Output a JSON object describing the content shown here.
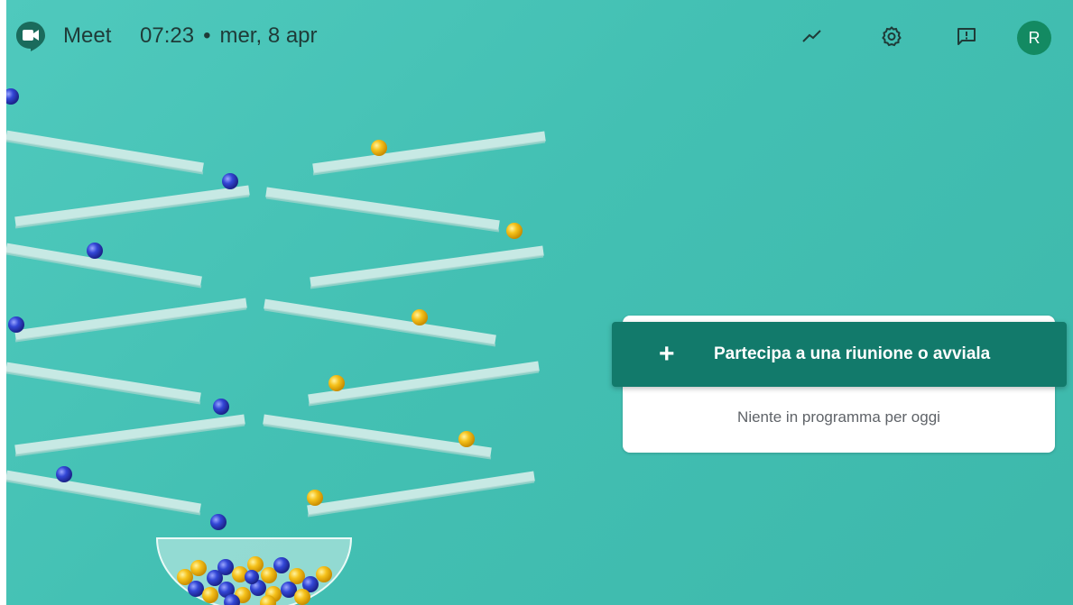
{
  "topbar": {
    "app_name": "Meet",
    "time": "07:23",
    "separator": "•",
    "date": "mer, 8 apr",
    "avatar_initial": "R",
    "icons": [
      "video-camera-logo",
      "activity-chart-icon",
      "gear-icon",
      "feedback-icon"
    ]
  },
  "main": {
    "join_button_icon": "+",
    "join_button_label": "Partecipa a una riunione o avviala",
    "empty_schedule_text": "Niente in programma per oggi"
  },
  "colors": {
    "background": "#43c0b3",
    "button": "#127a6b",
    "avatar": "#138a62",
    "logo": "#1a6b5c"
  }
}
